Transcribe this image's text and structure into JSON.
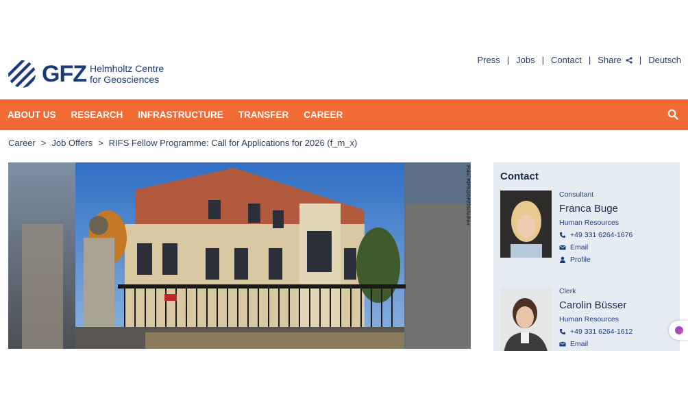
{
  "topnav": {
    "press": "Press",
    "jobs": "Jobs",
    "contact": "Contact",
    "share": "Share",
    "language": "Deutsch"
  },
  "logo": {
    "wordmark": "GFZ",
    "line1": "Helmholtz Centre",
    "line2": "for Geosciences"
  },
  "mainnav": {
    "items": [
      "ABOUT US",
      "RESEARCH",
      "INFRASTRUCTURE",
      "TRANSFER",
      "CAREER"
    ]
  },
  "breadcrumb": {
    "items": [
      "Career",
      "Job Offers",
      "RIFS Fellow Programme: Call for Applications for 2026 (f_m_x)"
    ]
  },
  "hero": {
    "credit": "Foto: RIFS@GFZ/Schulten"
  },
  "contact": {
    "title": "Contact",
    "people": [
      {
        "role": "Consultant",
        "name": "Franca Buge",
        "department": "Human Resources",
        "phone": "+49 331 6264-1676",
        "email_label": "Email",
        "profile_label": "Profile"
      },
      {
        "role": "Clerk",
        "name": "Carolin Büsser",
        "department": "Human Resources",
        "phone": "+49 331 6264-1612",
        "email_label": "Email"
      }
    ]
  },
  "colors": {
    "accent_orange": "#f26b34",
    "brand_blue": "#1a3a7a",
    "panel_bg": "#e6ecf3"
  }
}
